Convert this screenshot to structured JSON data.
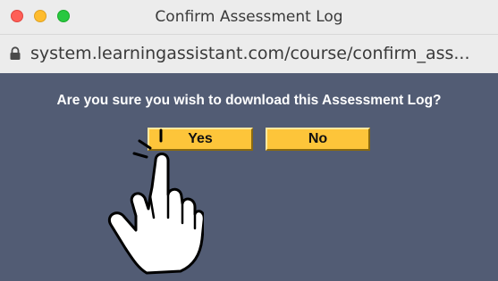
{
  "window": {
    "title": "Confirm Assessment Log",
    "url": "system.learningassistant.com/course/confirm_ass..."
  },
  "dialog": {
    "question": "Are you sure you wish to download this Assessment Log?",
    "yes_label": "Yes",
    "no_label": "No"
  },
  "colors": {
    "background": "#525c74",
    "button": "#fdc53a",
    "titlebar": "#ececec"
  },
  "icons": {
    "lock": "lock-icon",
    "cursor": "hand-pointer-cursor-icon"
  }
}
